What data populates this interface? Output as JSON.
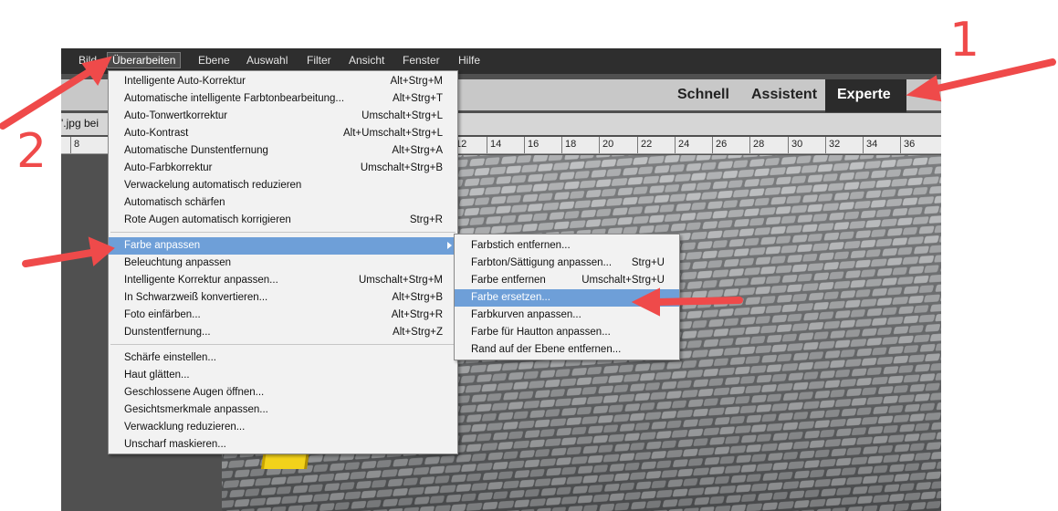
{
  "menubar": {
    "items": [
      "Bild",
      "Überarbeiten",
      "Ebene",
      "Auswahl",
      "Filter",
      "Ansicht",
      "Fenster",
      "Hilfe"
    ],
    "active": "Überarbeiten"
  },
  "modes": {
    "quick": "Schnell",
    "guided": "Assistent",
    "expert": "Experte"
  },
  "document": {
    "tab_label": "'.jpg bei"
  },
  "ruler": {
    "ticks": [
      "8",
      "12",
      "14",
      "16",
      "18",
      "20",
      "22",
      "24",
      "26",
      "28",
      "30",
      "32",
      "34",
      "36"
    ]
  },
  "main_menu": {
    "items": [
      {
        "label": "Intelligente Auto-Korrektur",
        "shortcut": "Alt+Strg+M"
      },
      {
        "label": "Automatische intelligente Farbtonbearbeitung...",
        "shortcut": "Alt+Strg+T"
      },
      {
        "label": "Auto-Tonwertkorrektur",
        "shortcut": "Umschalt+Strg+L"
      },
      {
        "label": "Auto-Kontrast",
        "shortcut": "Alt+Umschalt+Strg+L"
      },
      {
        "label": "Automatische Dunstentfernung",
        "shortcut": "Alt+Strg+A"
      },
      {
        "label": "Auto-Farbkorrektur",
        "shortcut": "Umschalt+Strg+B"
      },
      {
        "label": "Verwackelung automatisch reduzieren",
        "shortcut": ""
      },
      {
        "label": "Automatisch schärfen",
        "shortcut": ""
      },
      {
        "label": "Rote Augen automatisch korrigieren",
        "shortcut": "Strg+R"
      },
      {
        "label": "Farbe anpassen",
        "shortcut": ""
      },
      {
        "label": "Beleuchtung anpassen",
        "shortcut": ""
      },
      {
        "label": "Intelligente Korrektur anpassen...",
        "shortcut": "Umschalt+Strg+M"
      },
      {
        "label": "In Schwarzweiß konvertieren...",
        "shortcut": "Alt+Strg+B"
      },
      {
        "label": "Foto einfärben...",
        "shortcut": "Alt+Strg+R"
      },
      {
        "label": "Dunstentfernung...",
        "shortcut": "Alt+Strg+Z"
      },
      {
        "label": "Schärfe einstellen...",
        "shortcut": ""
      },
      {
        "label": "Haut glätten...",
        "shortcut": ""
      },
      {
        "label": "Geschlossene Augen öffnen...",
        "shortcut": ""
      },
      {
        "label": "Gesichtsmerkmale anpassen...",
        "shortcut": ""
      },
      {
        "label": "Verwacklung reduzieren...",
        "shortcut": ""
      },
      {
        "label": "Unscharf maskieren...",
        "shortcut": ""
      }
    ]
  },
  "submenu": {
    "items": [
      {
        "label": "Farbstich entfernen...",
        "shortcut": ""
      },
      {
        "label": "Farbton/Sättigung anpassen...",
        "shortcut": "Strg+U"
      },
      {
        "label": "Farbe entfernen",
        "shortcut": "Umschalt+Strg+U"
      },
      {
        "label": "Farbe ersetzen...",
        "shortcut": ""
      },
      {
        "label": "Farbkurven anpassen...",
        "shortcut": ""
      },
      {
        "label": "Farbe für Hautton anpassen...",
        "shortcut": ""
      },
      {
        "label": "Rand auf der Ebene entfernen...",
        "shortcut": ""
      }
    ]
  },
  "annotations": {
    "one": "1",
    "two": "2"
  },
  "colors": {
    "highlight": "#6e9fd8",
    "annotation": "#ef4a4a",
    "pole": "#f2d21a"
  }
}
